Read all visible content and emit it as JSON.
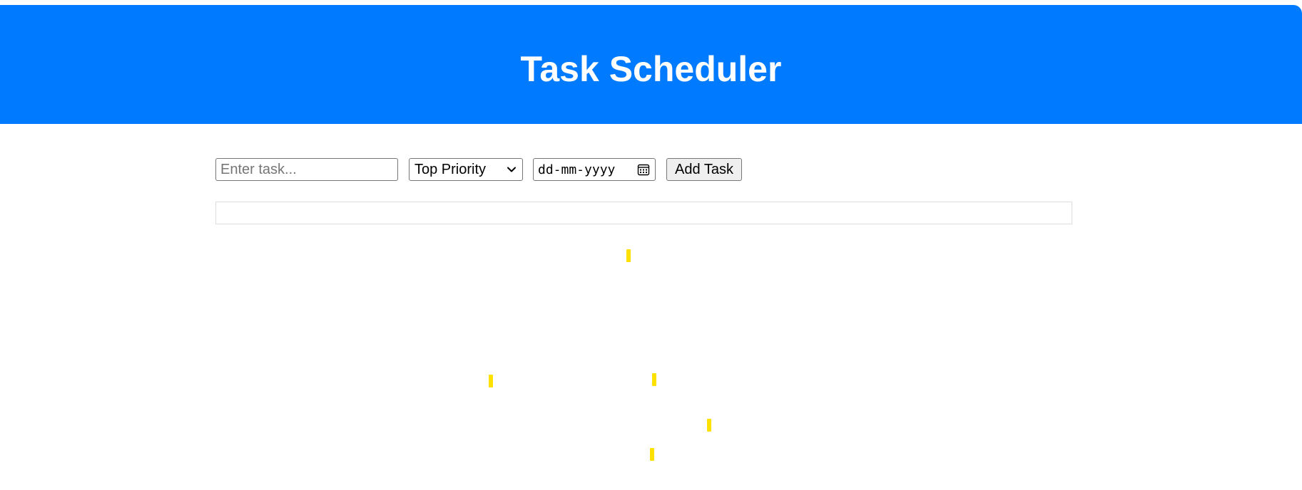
{
  "header": {
    "title": "Task Scheduler"
  },
  "form": {
    "task_placeholder": "Enter task...",
    "task_value": "",
    "priority_selected": "Top Priority",
    "date_placeholder": "dd-mm-yyyy",
    "add_button_label": "Add Task"
  },
  "task_list": {
    "items": []
  },
  "icons": {
    "priority_dropdown": "chevron-down-icon",
    "date_picker": "calendar-icon"
  },
  "colors": {
    "header_background": "#007bff",
    "header_text": "#ffffff",
    "confetti": "#ffe100"
  }
}
